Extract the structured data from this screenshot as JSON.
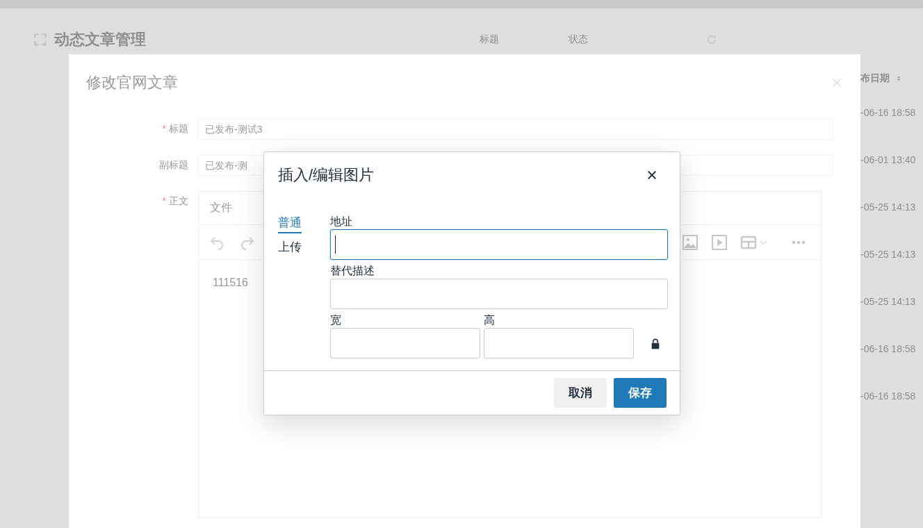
{
  "page": {
    "title": "动态文章管理",
    "filters": [
      {
        "label": "标题"
      },
      {
        "label": "状态"
      }
    ]
  },
  "table": {
    "columns": [
      {
        "label": "布日期",
        "sortable": true
      }
    ],
    "rows": [
      {
        "date": "-06-16 18:58"
      },
      {
        "date": "-06-01 13:40"
      },
      {
        "date": "-05-25 14:13"
      },
      {
        "date": "-05-25 14:13"
      },
      {
        "date": "-05-25 14:13"
      },
      {
        "date": "-06-16 18:58"
      },
      {
        "date": "-06-16 18:58"
      }
    ]
  },
  "modal": {
    "title": "修改官网文章",
    "fields": [
      {
        "kind": "input",
        "label": "标题",
        "required_mark": "*",
        "value": "已发布-测试3"
      },
      {
        "kind": "input",
        "label": "副标题",
        "value": "已发布-测"
      },
      {
        "kind": "editor",
        "label": "正文",
        "required_mark": "*"
      }
    ],
    "editor": {
      "menu": [
        "文件"
      ],
      "content": "111516"
    }
  },
  "dialog": {
    "title": "插入/编辑图片",
    "tabs": [
      {
        "label": "普通",
        "selected": true
      },
      {
        "label": "上传",
        "selected": false
      }
    ],
    "fields": [
      {
        "kind": "full",
        "label": "地址",
        "focused": true
      },
      {
        "kind": "full",
        "label": "替代描述",
        "focused": false
      },
      {
        "kind": "half",
        "label": "宽",
        "focused": false
      },
      {
        "kind": "half",
        "label": "高",
        "focused": false
      }
    ],
    "locked": true,
    "buttons": [
      {
        "label": "取消",
        "kind": "secondary"
      },
      {
        "label": "保存",
        "kind": "primary"
      }
    ]
  }
}
